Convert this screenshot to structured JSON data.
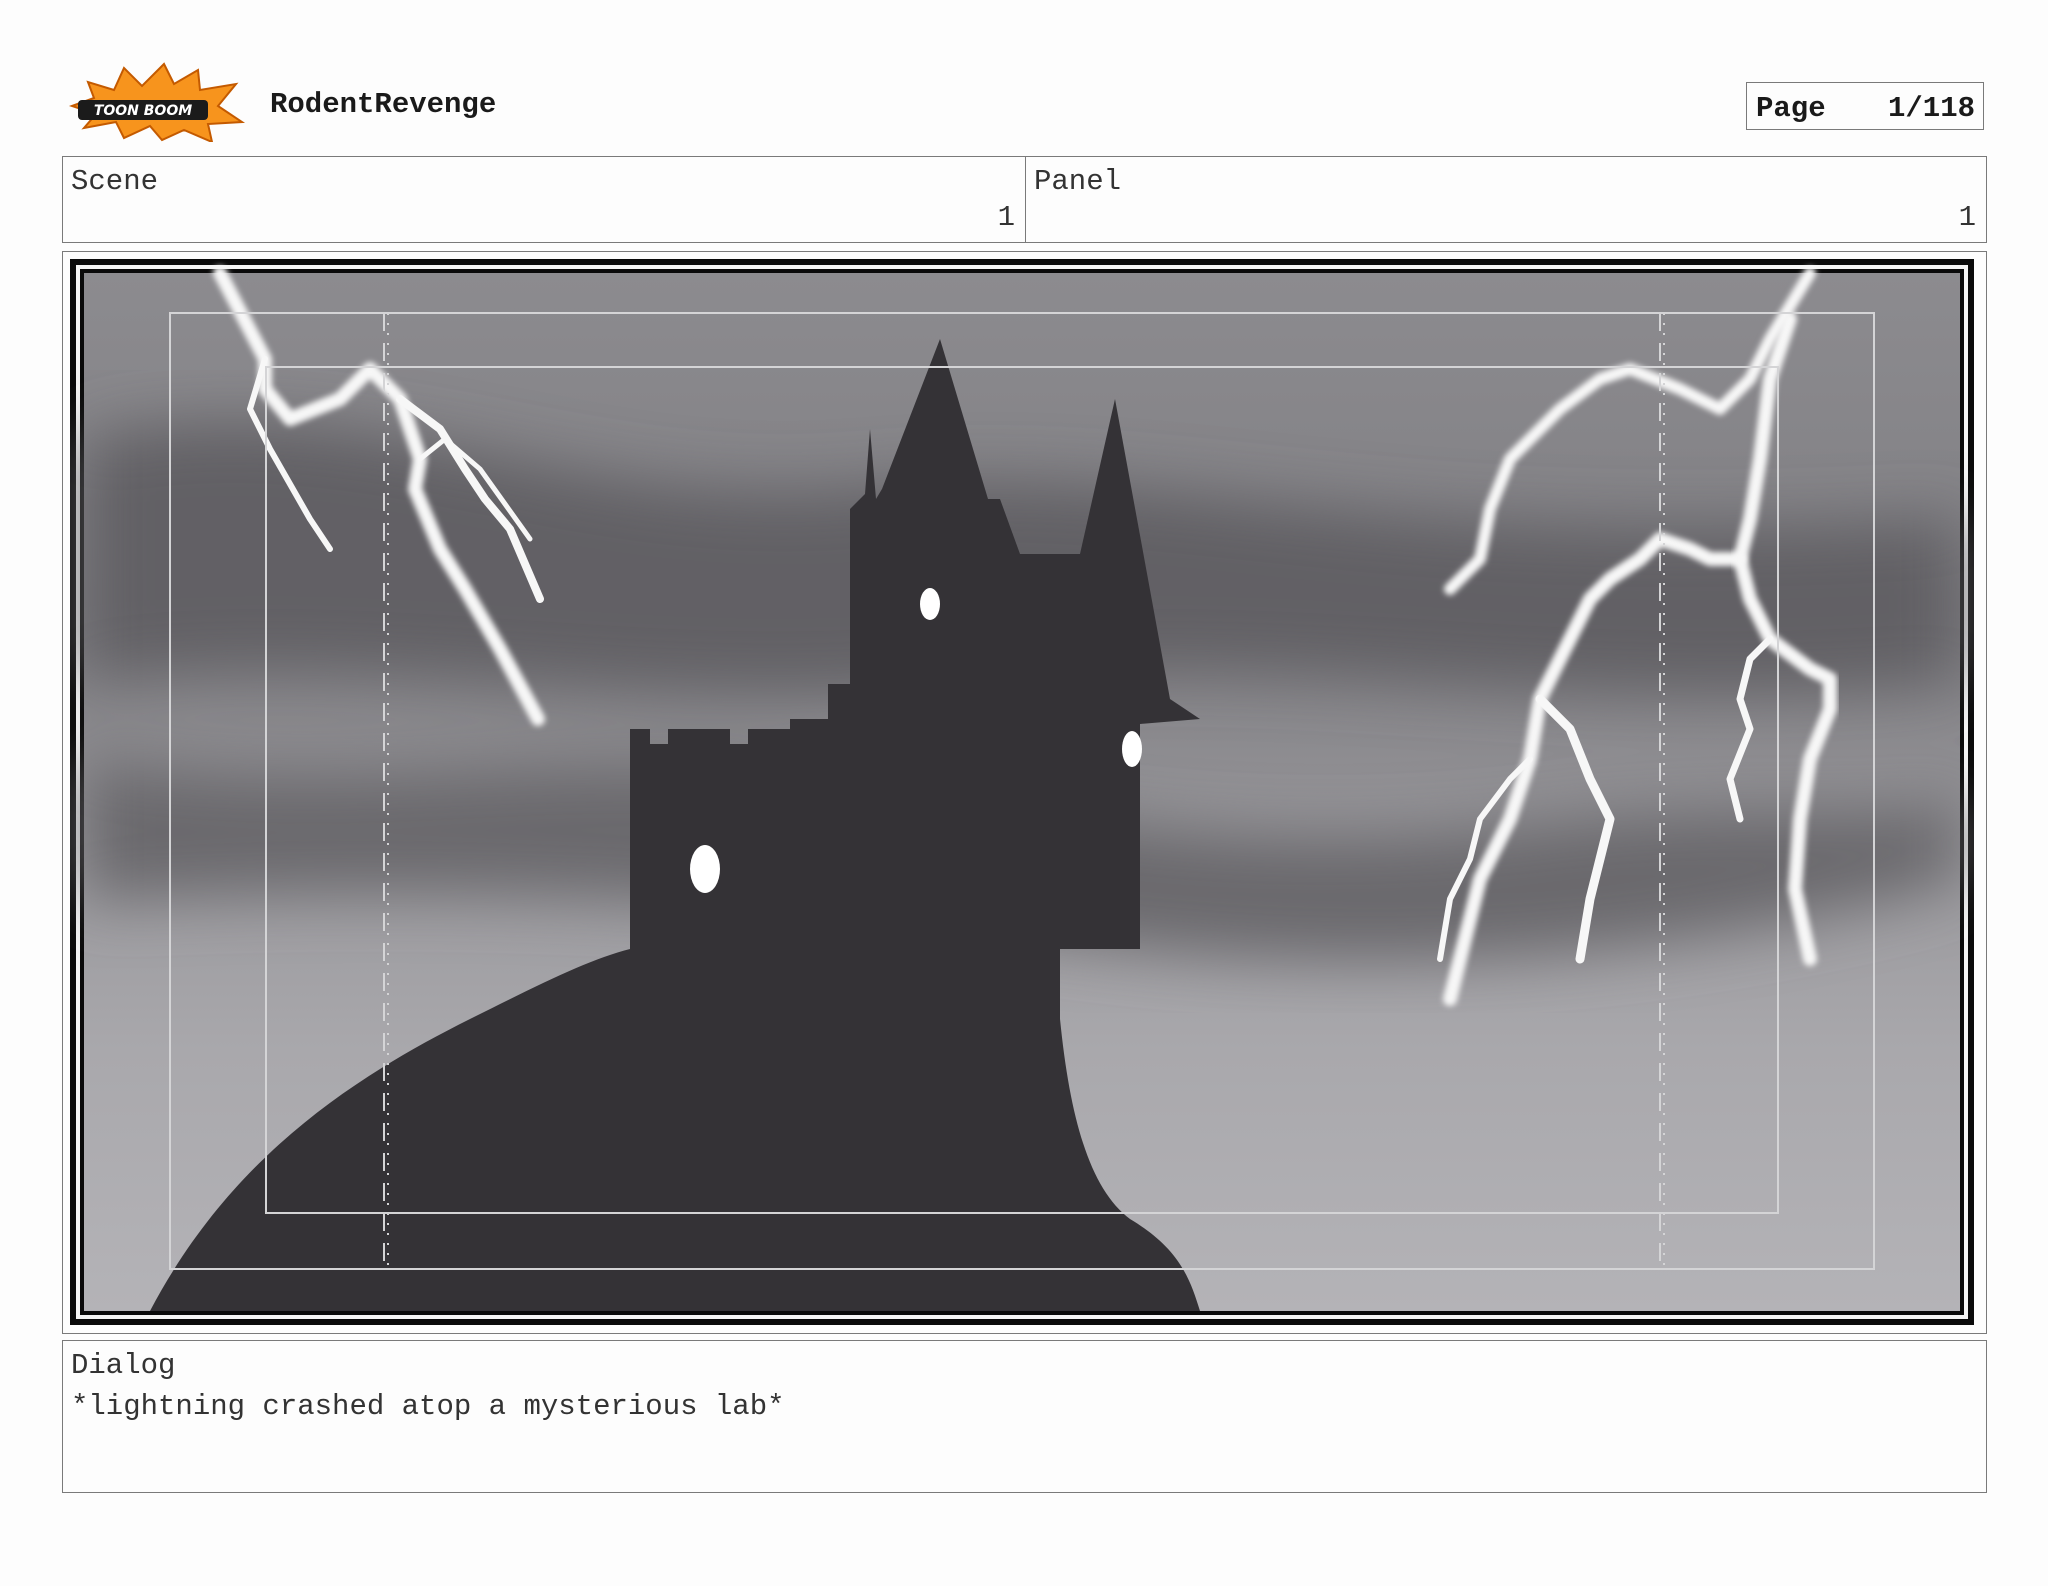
{
  "header": {
    "project_title": "RodentRevenge",
    "page_label": "Page",
    "page_value": "1/118"
  },
  "logo": {
    "text": "TOON BOOM"
  },
  "scene": {
    "label": "Scene",
    "value": "1"
  },
  "panel": {
    "label": "Panel",
    "value": "1"
  },
  "dialog": {
    "label": "Dialog",
    "text": "*lightning crashed atop a mysterious lab*"
  },
  "colors": {
    "sky_dark": "#6f6e72",
    "sky_light": "#b1b0b4",
    "castle": "#343236",
    "lightning": "#f7f7f7",
    "logo_orange": "#f7941d"
  }
}
